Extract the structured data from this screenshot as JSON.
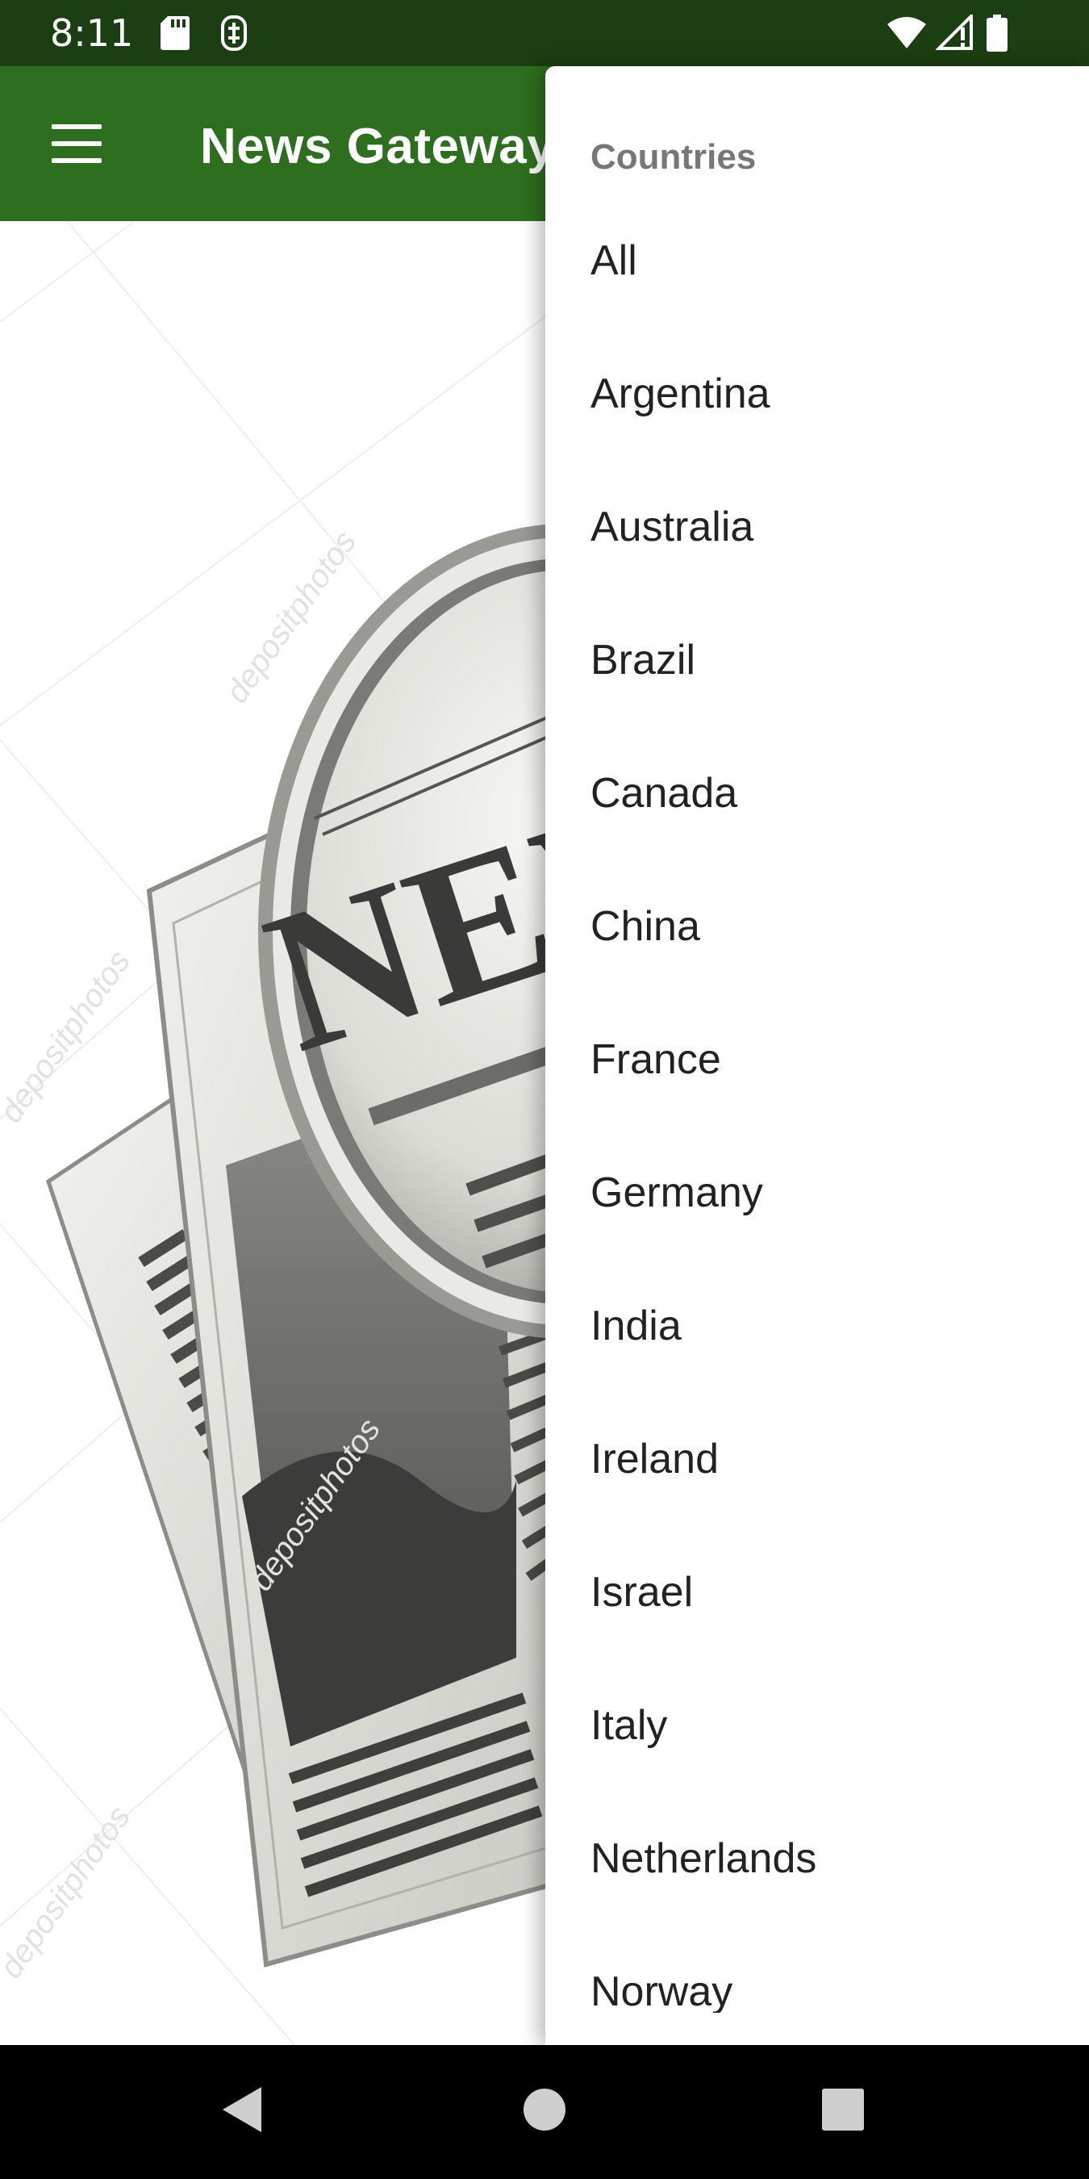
{
  "status_bar": {
    "time": "8:11",
    "icons": [
      "sd-card-icon",
      "sim-icon",
      "wifi-icon",
      "signal-icon",
      "battery-icon"
    ]
  },
  "app_bar": {
    "menu_icon": "menu-icon",
    "title": "News Gateway",
    "background_color": "#2d6f1e"
  },
  "background": {
    "image": "newspaper-magnifier-illustration",
    "image_text": "NEWS",
    "watermark": "depositphotos"
  },
  "drawer": {
    "header": "Countries",
    "items": [
      {
        "label": "All"
      },
      {
        "label": "Argentina"
      },
      {
        "label": "Australia"
      },
      {
        "label": "Brazil"
      },
      {
        "label": "Canada"
      },
      {
        "label": "China"
      },
      {
        "label": "France"
      },
      {
        "label": "Germany"
      },
      {
        "label": "India"
      },
      {
        "label": "Ireland"
      },
      {
        "label": "Israel"
      },
      {
        "label": "Italy"
      },
      {
        "label": "Netherlands"
      },
      {
        "label": "Norway"
      }
    ]
  },
  "nav_bar": {
    "icons": [
      "back-icon",
      "home-icon",
      "recents-icon"
    ]
  },
  "colors": {
    "status_bar": "#1b3e12",
    "app_bar": "#2d6f1e",
    "drawer_header": "#777777",
    "drawer_text": "#222222"
  }
}
